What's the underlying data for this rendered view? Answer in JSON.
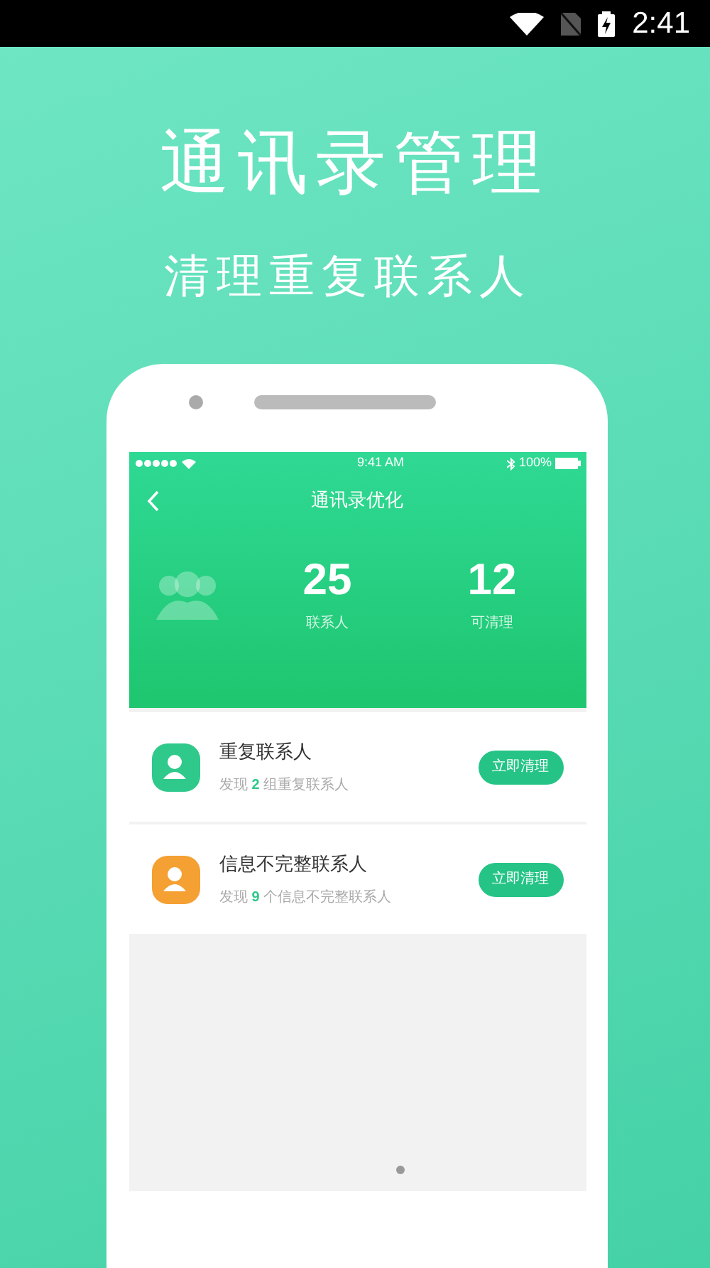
{
  "status_bar": {
    "time": "2:41"
  },
  "headline": "通讯录管理",
  "subheadline": "清理重复联系人",
  "phone": {
    "status_bar": {
      "time": "9:41 AM",
      "battery": "100%"
    },
    "title": "通讯录优化",
    "stats": [
      {
        "value": "25",
        "label": "联系人"
      },
      {
        "value": "12",
        "label": "可清理"
      }
    ],
    "items": [
      {
        "title": "重复联系人",
        "prefix": "发现",
        "count": "2",
        "suffix": "组重复联系人",
        "color": "#2ec98b",
        "button": "立即清理"
      },
      {
        "title": "信息不完整联系人",
        "prefix": "发现",
        "count": "9",
        "suffix": "个信息不完整联系人",
        "color": "#f5a033",
        "button": "立即清理"
      }
    ]
  }
}
